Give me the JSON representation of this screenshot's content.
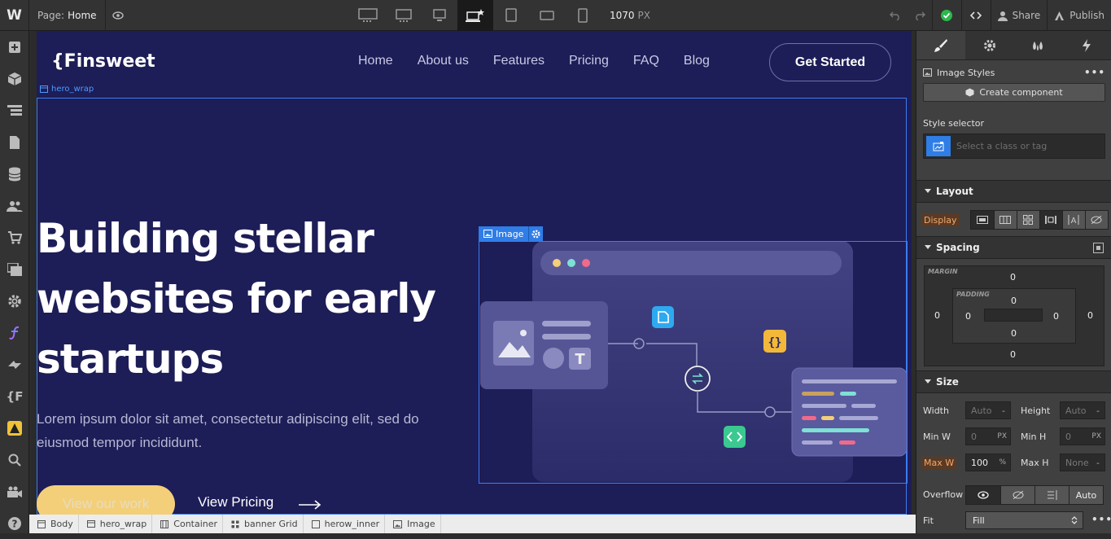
{
  "topbar": {
    "logo": "W",
    "page_label": "Page:",
    "page_name": "Home",
    "width_value": "1070",
    "width_unit": "PX",
    "share": "Share",
    "publish": "Publish"
  },
  "site": {
    "brand": "{Finsweet",
    "nav": [
      "Home",
      "About us",
      "Features",
      "Pricing",
      "FAQ",
      "Blog"
    ],
    "cta": "Get Started",
    "hero_label": "hero_wrap",
    "heading": "Building stellar websites for early startups",
    "lede": "Lorem ipsum dolor sit amet, consectetur adipiscing elit, sed do eiusmod tempor incididunt.",
    "primary_button": "View our work",
    "secondary_button": "View Pricing",
    "image_tag": "Image"
  },
  "breadcrumbs": [
    "Body",
    "hero_wrap",
    "Container",
    "banner Grid",
    "herow_inner",
    "Image"
  ],
  "panel": {
    "image_styles": "Image Styles",
    "create_component": "Create component",
    "style_selector": "Style selector",
    "selector_placeholder": "Select a class or tag",
    "layout": "Layout",
    "display": "Display",
    "spacing": "Spacing",
    "margin": "MARGIN",
    "padding": "PADDING",
    "margin_values": {
      "top": "0",
      "right": "0",
      "bottom": "0",
      "left": "0"
    },
    "padding_values": {
      "top": "0",
      "right": "0",
      "bottom": "0",
      "left": "0"
    },
    "size": "Size",
    "width": "Width",
    "height": "Height",
    "width_val": "Auto",
    "height_val": "Auto",
    "dash": "-",
    "min_w": "Min W",
    "min_h": "Min H",
    "min_w_val": "0",
    "min_h_val": "0",
    "px": "PX",
    "max_w": "Max W",
    "max_h": "Max H",
    "max_w_val": "100",
    "max_w_unit": "%",
    "max_h_val": "None",
    "overflow": "Overflow",
    "overflow_auto": "Auto",
    "fit": "Fit",
    "fit_val": "Fill"
  },
  "colors": {
    "site_bg": "#1d1d57",
    "accent_blue": "#3b7df0",
    "cta_yellow": "#f3cf7a",
    "publish_green": "#2db84d"
  }
}
